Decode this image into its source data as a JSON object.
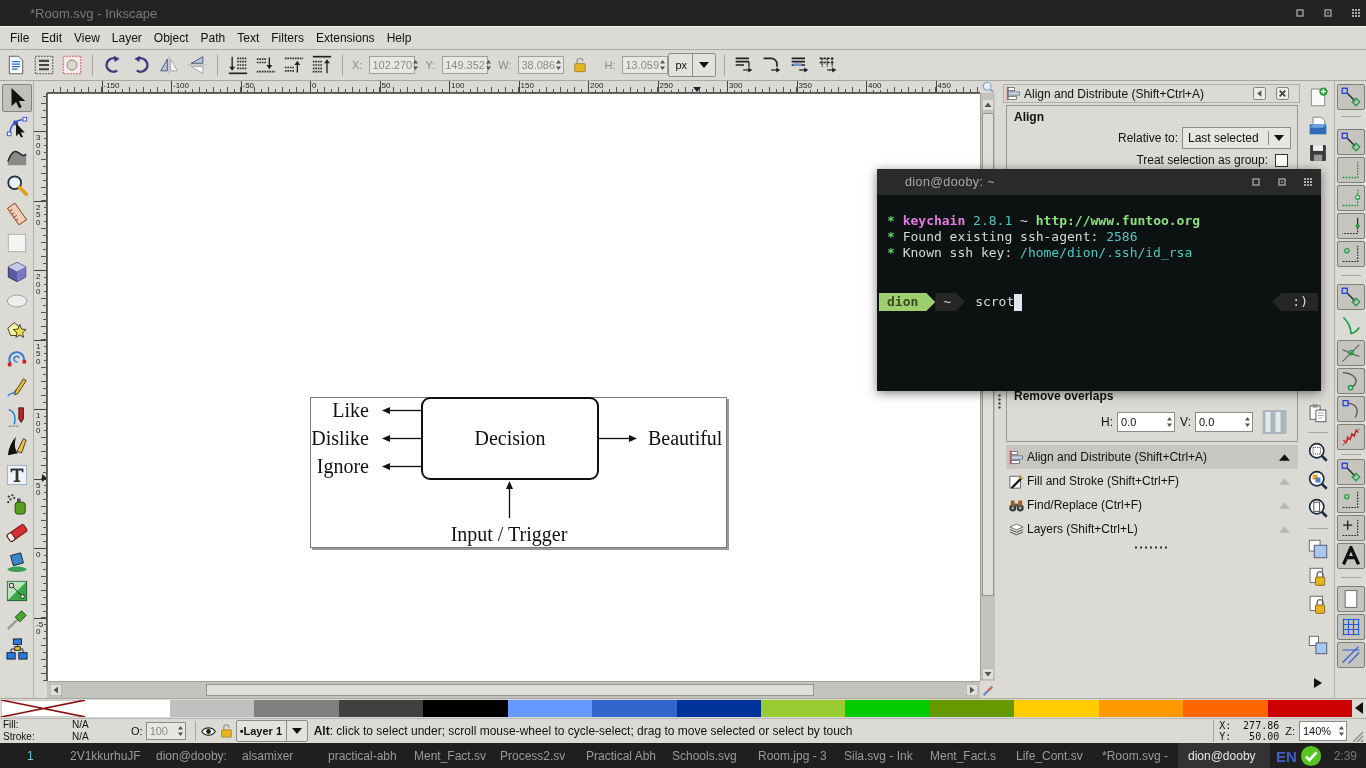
{
  "window": {
    "title": "*Room.svg - Inkscape"
  },
  "menu": [
    "File",
    "Edit",
    "View",
    "Layer",
    "Object",
    "Path",
    "Text",
    "Filters",
    "Extensions",
    "Help"
  ],
  "toolbar": {
    "fields": [
      {
        "label": "X:",
        "value": "102.270",
        "disabled": true
      },
      {
        "label": "Y:",
        "value": "149.352",
        "disabled": true
      },
      {
        "label": "W:",
        "value": "38.086",
        "disabled": true
      },
      {
        "label": "H:",
        "value": "13.059",
        "disabled": true
      }
    ],
    "unit": "px"
  },
  "tools": [
    {
      "kind": "selector",
      "selected": true
    },
    {
      "kind": "node",
      "selected": false
    },
    {
      "kind": "tweak",
      "selected": false
    },
    {
      "kind": "zoom",
      "selected": false
    },
    {
      "kind": "measure",
      "selected": false
    },
    {
      "kind": "rect",
      "selected": false
    },
    {
      "kind": "box3d",
      "selected": false
    },
    {
      "kind": "ellipse",
      "selected": false
    },
    {
      "kind": "star",
      "selected": false
    },
    {
      "kind": "spiral",
      "selected": false
    },
    {
      "kind": "pencil",
      "selected": false
    },
    {
      "kind": "pen",
      "selected": false
    },
    {
      "kind": "calligraphy",
      "selected": false
    },
    {
      "kind": "text",
      "selected": false
    },
    {
      "kind": "spray",
      "selected": false
    },
    {
      "kind": "eraser",
      "selected": false
    },
    {
      "kind": "bucket",
      "selected": false
    },
    {
      "kind": "gradient",
      "selected": false
    },
    {
      "kind": "dropper",
      "selected": false
    },
    {
      "kind": "connector",
      "selected": false
    }
  ],
  "rulers": {
    "horizontal": [
      "-150",
      "-100",
      "-50",
      "0",
      "50",
      "100",
      "150",
      "200",
      "250",
      "300",
      "350",
      "400",
      "450"
    ],
    "vertical": [
      "300",
      "250",
      "200",
      "150",
      "100",
      "50",
      "0",
      "-50"
    ]
  },
  "canvas": {
    "left_outputs": [
      "Like",
      "Dislike",
      "Ignore"
    ],
    "node": "Decision",
    "right_output": "Beautiful",
    "input": "Input / Trigger"
  },
  "align_panel": {
    "title": "Align and Distribute (Shift+Ctrl+A)",
    "align": {
      "heading": "Align",
      "relative_label": "Relative to:",
      "relative_value": "Last selected",
      "group_label": "Treat selection as group:",
      "group_checked": false
    },
    "remove_overlaps": {
      "heading": "Remove overlaps",
      "fields": [
        {
          "label": "H:",
          "value": "0.0"
        },
        {
          "label": "V:",
          "value": "0.0"
        }
      ]
    }
  },
  "dock_items": [
    {
      "kind": "align",
      "label": "Align and Distribute (Shift+Ctrl+A)",
      "selected": true
    },
    {
      "kind": "fill",
      "label": "Fill and Stroke (Shift+Ctrl+F)",
      "selected": false
    },
    {
      "kind": "find",
      "label": "Find/Replace (Ctrl+F)",
      "selected": false
    },
    {
      "kind": "layers",
      "label": "Layers (Shift+Ctrl+L)",
      "selected": false
    }
  ],
  "snap_bar": [
    [
      {
        "kind": "diagonal",
        "on": true
      }
    ],
    [
      {
        "kind": "diagonal",
        "on": true
      },
      {
        "kind": "corner",
        "on": true
      },
      {
        "kind": "corner_mid",
        "on": true
      },
      {
        "kind": "corner_node",
        "on": true
      },
      {
        "kind": "corner_dot",
        "on": true
      }
    ],
    [
      {
        "kind": "diagonal",
        "on": true
      },
      {
        "kind": "curve",
        "on": false
      },
      {
        "kind": "intersection",
        "on": true
      },
      {
        "kind": "curve_node",
        "on": true
      },
      {
        "kind": "curve_square",
        "on": true
      },
      {
        "kind": "zigzag",
        "on": true
      }
    ],
    [
      {
        "kind": "diagonal",
        "on": true
      },
      {
        "kind": "corner_dot",
        "on": true
      },
      {
        "kind": "cross",
        "on": true
      },
      {
        "kind": "letter",
        "on": true
      }
    ],
    [
      {
        "kind": "page",
        "on": true
      },
      {
        "kind": "grid",
        "on": true
      },
      {
        "kind": "guides",
        "on": true
      }
    ]
  ],
  "terminal": {
    "title": "dion@dooby: ~",
    "lines": [
      [
        {
          "text": "* ",
          "color": "#6ad36a",
          "bold": true
        },
        {
          "text": "keychain",
          "color": "#e27be2",
          "bold": true
        },
        {
          "text": " 2.8.1 ",
          "color": "#4fc7c0",
          "bold": false
        },
        {
          "text": "~ ",
          "bold": false
        },
        {
          "text": "http://www.funtoo.org",
          "color": "#8ee07e",
          "bold": true
        }
      ],
      [
        {
          "text": "* ",
          "color": "#6ad36a",
          "bold": true
        },
        {
          "text": "Found existing ssh-agent: ",
          "bold": false
        },
        {
          "text": "2586",
          "color": "#4fc7c0",
          "bold": false
        }
      ],
      [
        {
          "text": "* ",
          "color": "#6ad36a",
          "bold": true
        },
        {
          "text": "Known ssh key: ",
          "bold": false
        },
        {
          "text": "/home/dion/.ssh/id_rsa",
          "color": "#4fc7c0",
          "bold": false
        }
      ]
    ],
    "prompt": {
      "user": "dion",
      "dir": "~",
      "command": "scrot",
      "status": ":)"
    }
  },
  "palette": [
    {
      "kind": "none"
    },
    {
      "kind": "color",
      "color": "#ffffff"
    },
    {
      "kind": "color",
      "color": "#c0c0c0"
    },
    {
      "kind": "color",
      "color": "#808080"
    },
    {
      "kind": "color",
      "color": "#404040"
    },
    {
      "kind": "color",
      "color": "#000000"
    },
    {
      "kind": "color",
      "color": "#6699ff"
    },
    {
      "kind": "color",
      "color": "#3366cc"
    },
    {
      "kind": "color",
      "color": "#003399"
    },
    {
      "kind": "color",
      "color": "#99cc33"
    },
    {
      "kind": "color",
      "color": "#00cc00"
    },
    {
      "kind": "color",
      "color": "#669900"
    },
    {
      "kind": "color",
      "color": "#ffcc00"
    },
    {
      "kind": "color",
      "color": "#ff9900"
    },
    {
      "kind": "color",
      "color": "#ff6600"
    },
    {
      "kind": "color",
      "color": "#cc0000"
    }
  ],
  "status_bar": {
    "fill_label": "Fill:",
    "fill_value": "N/A",
    "stroke_label": "Stroke:",
    "stroke_value": "N/A",
    "opacity_label": "O:",
    "opacity_value": "100",
    "opacity_disabled": true,
    "layer": "•Layer 1",
    "message": "**Alt**: click to select under; scroll mouse-wheel to cycle-select; drag to move selected or select by touch",
    "x_label": "X:",
    "x_value": "277.86",
    "y_label": "Y:",
    "y_value": "50.00",
    "zoom_label": "Z:",
    "zoom_value": "140%"
  },
  "taskbar": {
    "workspace": "1",
    "tasks": [
      {
        "label": "2V1kkurhuJF",
        "selected": false
      },
      {
        "label": "dion@dooby:",
        "selected": false
      },
      {
        "label": "alsamixer",
        "selected": false
      },
      {
        "label": "practical-abh",
        "selected": false
      },
      {
        "label": "Ment_Fact.sv",
        "selected": false
      },
      {
        "label": "Process2.sv",
        "selected": false
      },
      {
        "label": "Practical Abh",
        "selected": false
      },
      {
        "label": "Schools.svg",
        "selected": false
      },
      {
        "label": "Room.jpg - 3",
        "selected": false
      },
      {
        "label": "Sila.svg - Ink",
        "selected": false
      },
      {
        "label": "Ment_Fact.s",
        "selected": false
      },
      {
        "label": "Life_Cont.sv",
        "selected": false
      },
      {
        "label": "*Room.svg -",
        "selected": false
      },
      {
        "label": "dion@dooby",
        "selected": true
      }
    ],
    "layout": "EN",
    "clock": "2:39"
  }
}
